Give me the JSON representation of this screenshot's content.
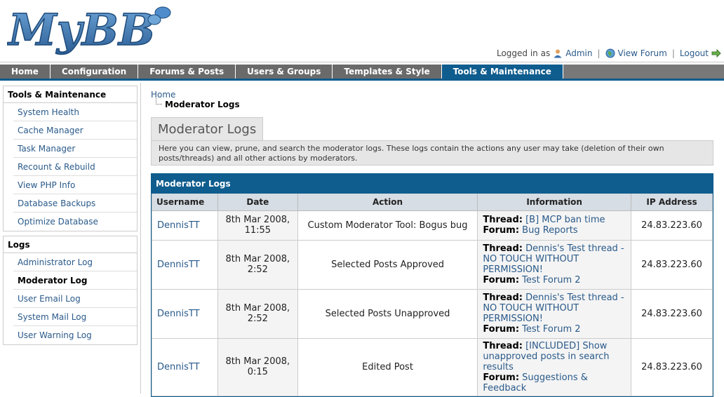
{
  "header": {
    "logo_text": "MyBB",
    "logged_in_as": "Logged in as",
    "user": "Admin",
    "view_forum": "View Forum",
    "logout": "Logout"
  },
  "nav": {
    "tabs": [
      "Home",
      "Configuration",
      "Forums & Posts",
      "Users & Groups",
      "Templates & Style",
      "Tools & Maintenance"
    ],
    "active_index": 5
  },
  "sidebar": {
    "tools": {
      "title": "Tools & Maintenance",
      "items": [
        "System Health",
        "Cache Manager",
        "Task Manager",
        "Recount & Rebuild",
        "View PHP Info",
        "Database Backups",
        "Optimize Database"
      ]
    },
    "logs": {
      "title": "Logs",
      "items": [
        "Administrator Log",
        "Moderator Log",
        "User Email Log",
        "System Mail Log",
        "User Warning Log"
      ],
      "active_index": 1
    }
  },
  "breadcrumb": {
    "home": "Home",
    "current": "Moderator Logs"
  },
  "page": {
    "title": "Moderator Logs",
    "description": "Here you can view, prune, and search the moderator logs. These logs contain the actions any user may take (deletion of their own posts/threads) and all other actions by moderators."
  },
  "table": {
    "title": "Moderator Logs",
    "columns": [
      "Username",
      "Date",
      "Action",
      "Information",
      "IP Address"
    ],
    "rows": [
      {
        "username": "DennisTT",
        "date": "8th Mar 2008, 11:55",
        "action": "Custom Moderator Tool: Bogus bug",
        "thread_label": "Thread:",
        "thread": "[B] MCP ban time",
        "forum_label": "Forum:",
        "forum": "Bug Reports",
        "ip": "24.83.223.60"
      },
      {
        "username": "DennisTT",
        "date": "8th Mar 2008, 2:52",
        "action": "Selected Posts Approved",
        "thread_label": "Thread:",
        "thread": "Dennis's Test thread - NO TOUCH WITHOUT PERMISSION!",
        "forum_label": "Forum:",
        "forum": "Test Forum 2",
        "ip": "24.83.223.60"
      },
      {
        "username": "DennisTT",
        "date": "8th Mar 2008, 2:52",
        "action": "Selected Posts Unapproved",
        "thread_label": "Thread:",
        "thread": "Dennis's Test thread - NO TOUCH WITHOUT PERMISSION!",
        "forum_label": "Forum:",
        "forum": "Test Forum 2",
        "ip": "24.83.223.60"
      },
      {
        "username": "DennisTT",
        "date": "8th Mar 2008, 0:15",
        "action": "Edited Post",
        "thread_label": "Thread:",
        "thread": "[INCLUDED] Show unapproved posts in search results",
        "forum_label": "Forum:",
        "forum": "Suggestions & Feedback",
        "ip": "24.83.223.60"
      }
    ]
  },
  "colors": {
    "accent": "#0f5c8e",
    "nav_bg": "#787878",
    "link": "#2a5a8a",
    "logo": "#2e6da4"
  },
  "icons": {
    "user": "user-icon",
    "globe": "globe-icon",
    "logout": "arrow-right-icon"
  }
}
